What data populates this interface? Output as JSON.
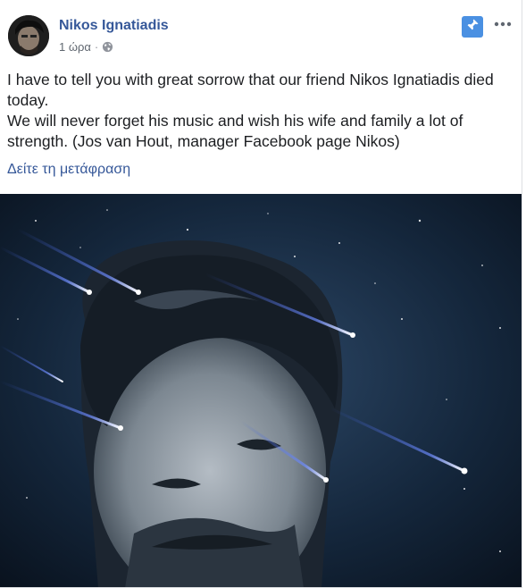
{
  "post": {
    "author": "Nikos Ignatiadis",
    "timestamp": "1 ώρα",
    "separator": "·",
    "audience_icon": "globe-icon",
    "pin_icon": "pin-icon",
    "more_icon": "more-options-icon",
    "text_lines": [
      "I have to tell you with great sorrow that our friend Nikos Ignatiadis died",
      "today.",
      "We will never forget his music and wish his wife and family a lot of",
      "strength. (Jos van Hout, manager Facebook page Nikos)"
    ],
    "translate_link": "Δείτε τη μετάφραση"
  },
  "colors": {
    "link": "#365899",
    "text": "#1c1e21",
    "meta": "#606770",
    "pin_bg": "#4a90e2",
    "photo_bg": "#0b1522"
  }
}
